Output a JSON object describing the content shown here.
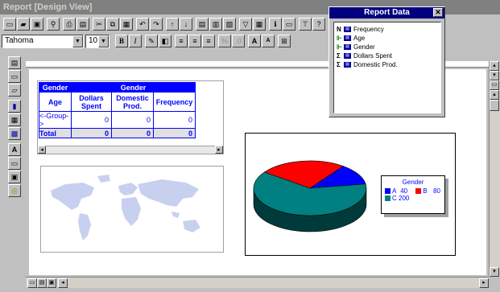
{
  "window": {
    "title": "Report [Design View]"
  },
  "toolbar": {
    "font_name": "Tahoma",
    "font_size": "10",
    "bold": "B",
    "italic": "I",
    "grow_text": "A",
    "shrink_text": "A"
  },
  "report_data": {
    "title": "Report Data",
    "close": "✕",
    "fields": [
      {
        "icon": "N",
        "label": "Frequency"
      },
      {
        "icon": "⊩",
        "label": "Age"
      },
      {
        "icon": "⊩",
        "label": "Gender"
      },
      {
        "icon": "Σ",
        "label": "Dollars Spent"
      },
      {
        "icon": "Σ",
        "label": "Domestic Prod."
      }
    ]
  },
  "crosstab": {
    "group_header_left": "Gender",
    "group_header_right": "Gender",
    "col_row": "Age",
    "columns": [
      "Dollars Spent",
      "Domestic Prod.",
      "Frequency"
    ],
    "rows": [
      {
        "label": "<-Group->",
        "values": [
          "0",
          "0",
          "0"
        ]
      },
      {
        "label": "Total",
        "values": [
          "0",
          "0",
          "0"
        ]
      }
    ]
  },
  "chart_data": {
    "type": "pie",
    "title": "",
    "legend_title": "Gender",
    "categories": [
      "A",
      "B",
      "C"
    ],
    "values": [
      40,
      80,
      200
    ],
    "colors": [
      "#0000ff",
      "#ff0000",
      "#008080"
    ]
  },
  "legend": {
    "title": "Gender",
    "items": [
      {
        "label": "A",
        "value": "40"
      },
      {
        "label": "B",
        "value": "80"
      },
      {
        "label": "C",
        "value": "200"
      }
    ]
  },
  "colors": {
    "accent": "#0000ff",
    "popup_title": "#000080",
    "map": "#c8d0f0"
  }
}
